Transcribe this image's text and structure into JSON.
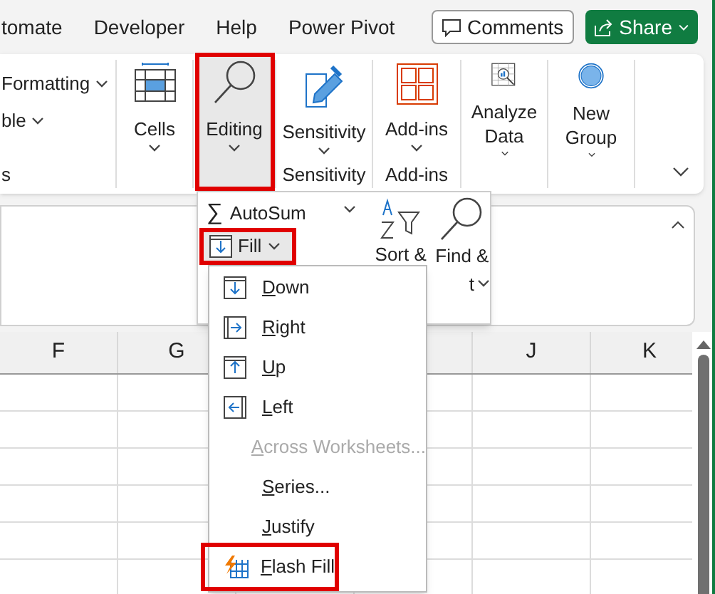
{
  "tabs": [
    {
      "label": "tomate",
      "selected": false
    },
    {
      "label": "Developer",
      "selected": false
    },
    {
      "label": "Help",
      "selected": false
    },
    {
      "label": "Power Pivot",
      "selected": false
    }
  ],
  "comments_button": "Comments",
  "share_button": "Share",
  "ribbon": {
    "partial_items": [
      "Formatting",
      "ble"
    ],
    "partial_group_label": "s",
    "groups": [
      {
        "kind": "cells",
        "label": "Cells",
        "selected": false
      },
      {
        "kind": "editing",
        "label": "Editing",
        "selected": true
      },
      {
        "kind": "sensitivity",
        "label": "Sensitivity",
        "selected": false,
        "group_label": "Sensitivity"
      },
      {
        "kind": "addins",
        "label": "Add-ins",
        "selected": false,
        "group_label": "Add-ins"
      },
      {
        "kind": "analyze",
        "label": "Analyze Data",
        "selected": false
      },
      {
        "kind": "newgroup",
        "label": "New Group",
        "selected": false
      }
    ]
  },
  "editing_menu": {
    "sigma": "∑",
    "autosum": "AutoSum",
    "fill": {
      "label": "Fill",
      "highlighted": true
    },
    "sort": "Sort &",
    "find": "Find &",
    "find_tail": "t"
  },
  "fill_menu": {
    "items": [
      {
        "kind": "down",
        "label": "Down",
        "disabled": false,
        "highlighted": false
      },
      {
        "kind": "right",
        "label": "Right",
        "disabled": false,
        "highlighted": false
      },
      {
        "kind": "up",
        "label": "Up",
        "disabled": false,
        "highlighted": false
      },
      {
        "kind": "left",
        "label": "Left",
        "disabled": false,
        "highlighted": false
      },
      {
        "kind": "none",
        "label": "Across Worksheets...",
        "disabled": true,
        "highlighted": false
      },
      {
        "kind": "none",
        "label": "Series...",
        "disabled": false,
        "highlighted": false
      },
      {
        "kind": "none",
        "label": "Justify",
        "disabled": false,
        "highlighted": false
      },
      {
        "kind": "flash",
        "label": "Flash Fill",
        "disabled": false,
        "highlighted": true
      }
    ]
  },
  "left_columns": [
    "F",
    "G"
  ],
  "right_columns": [
    "J",
    "K"
  ]
}
